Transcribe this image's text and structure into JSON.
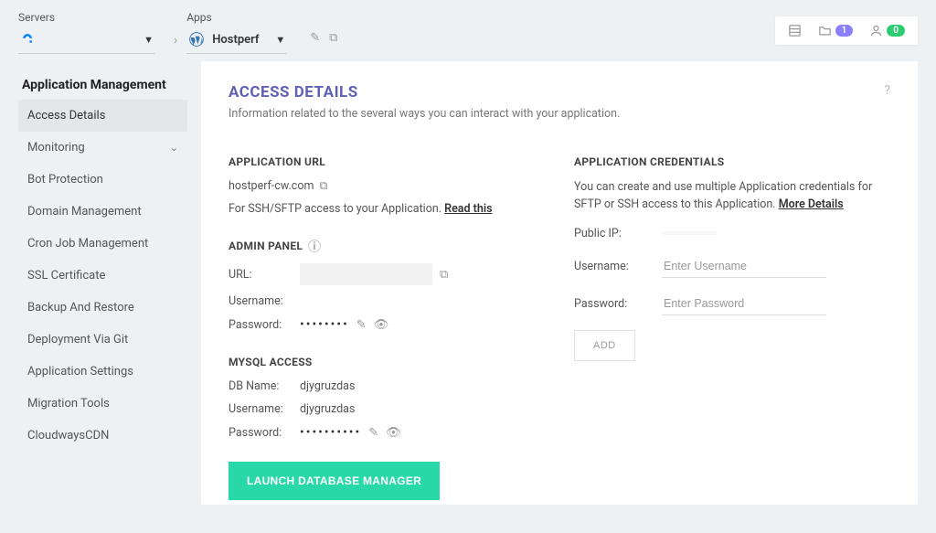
{
  "breadcrumb": {
    "servers_label": "Servers",
    "server_name": "",
    "apps_label": "Apps",
    "app_name": "Hostperf"
  },
  "header": {
    "projects_badge": "1",
    "user_badge": "0"
  },
  "sidebar": {
    "title": "Application Management",
    "items": [
      {
        "label": "Access Details",
        "active": true
      },
      {
        "label": "Monitoring",
        "expandable": true
      },
      {
        "label": "Bot Protection"
      },
      {
        "label": "Domain Management"
      },
      {
        "label": "Cron Job Management"
      },
      {
        "label": "SSL Certificate"
      },
      {
        "label": "Backup And Restore"
      },
      {
        "label": "Deployment Via Git"
      },
      {
        "label": "Application Settings"
      },
      {
        "label": "Migration Tools"
      },
      {
        "label": "CloudwaysCDN"
      }
    ]
  },
  "main": {
    "title": "ACCESS DETAILS",
    "subtitle": "Information related to the several ways you can interact with your application."
  },
  "app_url": {
    "title": "APPLICATION URL",
    "url": "hostperf-cw.com",
    "ssh_note_prefix": "For SSH/SFTP access to your Application. ",
    "ssh_link": "Read this"
  },
  "admin_panel": {
    "title": "ADMIN PANEL",
    "url_label": "URL:",
    "url_value": "",
    "username_label": "Username:",
    "username_value": "",
    "password_label": "Password:",
    "password_mask": "••••••••"
  },
  "mysql": {
    "title": "MYSQL ACCESS",
    "dbname_label": "DB Name:",
    "dbname_value": "djygruzdas",
    "username_label": "Username:",
    "username_value": "djygruzdas",
    "password_label": "Password:",
    "password_mask": "••••••••••",
    "launch_btn": "LAUNCH DATABASE MANAGER"
  },
  "credentials": {
    "title": "APPLICATION CREDENTIALS",
    "lead": "You can create and use multiple Application credentials for SFTP or SSH access to this Application. ",
    "more_link": "More Details",
    "public_ip_label": "Public IP:",
    "public_ip_value": "",
    "username_label": "Username:",
    "username_placeholder": "Enter Username",
    "password_label": "Password:",
    "password_placeholder": "Enter Password",
    "add_btn": "ADD"
  }
}
